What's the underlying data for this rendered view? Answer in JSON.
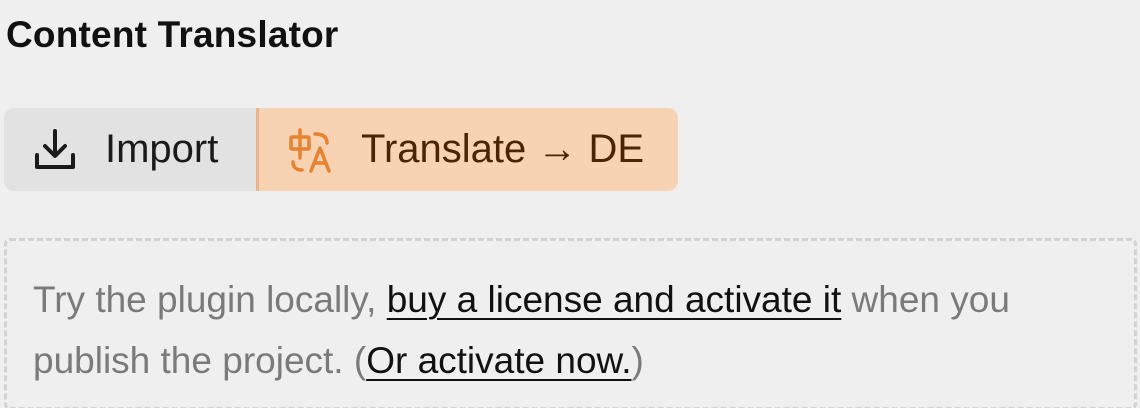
{
  "panel": {
    "title": "Content Translator"
  },
  "toolbar": {
    "import_label": "Import",
    "translate_label": "Translate → DE",
    "import_icon": "download-icon",
    "translate_icon": "translate-icon"
  },
  "notice": {
    "text_before": "Try the plugin locally, ",
    "buy_link": "buy a license and activate it",
    "text_middle": " when you publish the project. (",
    "activate_link": "Or activate now.",
    "text_after": ")"
  },
  "colors": {
    "background": "#efefef",
    "import_button_bg": "#e2e2e2",
    "translate_button_bg": "#f7d2b3",
    "translate_accent": "#e8822e"
  }
}
